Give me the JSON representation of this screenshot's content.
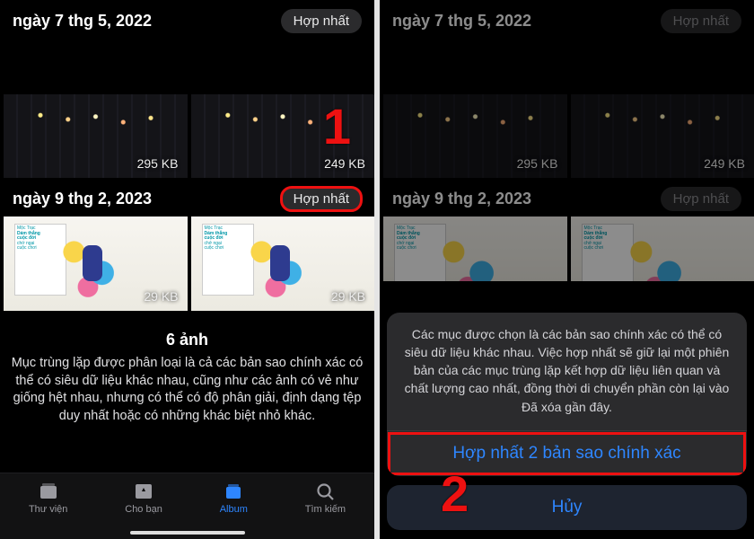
{
  "left": {
    "group1": {
      "date": "ngày 7 thg 5, 2022",
      "merge": "Hợp nhất",
      "sizes": [
        "295 KB",
        "249 KB"
      ]
    },
    "group2": {
      "date": "ngày 9 thg 2, 2023",
      "merge": "Hợp nhất",
      "sizes": [
        "29 KB",
        "29 KB"
      ],
      "book": {
        "line1": "Mộc Trạc",
        "title1": "Dám thẳng",
        "title2": "cuộc đời",
        "title3": "chớ ngại",
        "title4": "cuộc chơi"
      }
    },
    "summary": {
      "title": "6 ảnh",
      "body": "Mục trùng lặp được phân loại là cả các bản sao chính xác có thể có siêu dữ liệu khác nhau, cũng như các ảnh có vẻ như giống hệt nhau, nhưng có thể có độ phân giải, định dạng tệp duy nhất hoặc có những khác biệt nhỏ khác."
    },
    "tabs": {
      "library": "Thư viện",
      "for_you": "Cho bạn",
      "album": "Album",
      "search": "Tìm kiếm"
    },
    "callout": "1"
  },
  "right": {
    "group1": {
      "date": "ngày 7 thg 5, 2022",
      "merge": "Hợp nhất",
      "sizes": [
        "295 KB",
        "249 KB"
      ]
    },
    "group2": {
      "date": "ngày 9 thg 2, 2023",
      "merge": "Hợp nhất"
    },
    "sheet": {
      "message": "Các mục được chọn là các bản sao chính xác có thể có siêu dữ liệu khác nhau. Việc hợp nhất sẽ giữ lại một phiên bản của các mục trùng lặp kết hợp dữ liệu liên quan và chất lượng cao nhất, đồng thời di chuyển phần còn lại vào Đã xóa gần đây.",
      "confirm": "Hợp nhất 2 bản sao chính xác",
      "cancel": "Hủy"
    },
    "callout": "2"
  }
}
